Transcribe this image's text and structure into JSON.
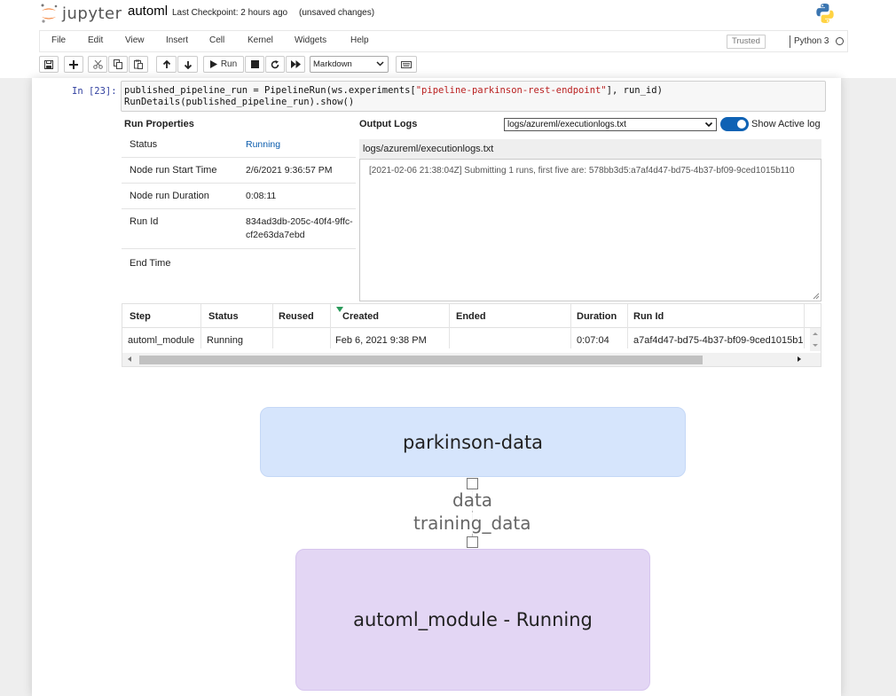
{
  "header": {
    "logo_text": "jupyter",
    "notebook_name": "automl",
    "checkpoint": "Last Checkpoint: 2 hours ago",
    "unsaved": "(unsaved changes)"
  },
  "menu": {
    "items": [
      "File",
      "Edit",
      "View",
      "Insert",
      "Cell",
      "Kernel",
      "Widgets",
      "Help"
    ],
    "trusted": "Trusted",
    "kernel_name": "Python 3"
  },
  "toolbar": {
    "run_label": "Run",
    "cell_type": "Markdown"
  },
  "cell": {
    "prompt": "In [23]:",
    "code_line1_a": "published_pipeline_run = PipelineRun(ws.experiments[",
    "code_line1_str": "\"pipeline-parkinson-rest-endpoint\"",
    "code_line1_b": "], run_id)",
    "code_line2": "RunDetails(published_pipeline_run).show()"
  },
  "run_properties": {
    "title": "Run Properties",
    "rows": [
      {
        "key": "Status",
        "value": "Running"
      },
      {
        "key": "Node run Start Time",
        "value": "2/6/2021 9:36:57 PM"
      },
      {
        "key": "Node run Duration",
        "value": "0:08:11"
      },
      {
        "key": "Run Id",
        "value": "834ad3db-205c-40f4-9ffc-cf2e63da7ebd"
      },
      {
        "key": "End Time",
        "value": ""
      }
    ]
  },
  "output_logs": {
    "title": "Output Logs",
    "selected_file": "logs/azureml/executionlogs.txt",
    "toggle_label": "Show Active log",
    "toggle_on": true,
    "log_header": "logs/azureml/executionlogs.txt",
    "log_text": "[2021-02-06 21:38:04Z] Submitting 1 runs, first five are: 578bb3d5:a7af4d47-bd75-4b37-bf09-9ced1015b110"
  },
  "steps_table": {
    "columns": [
      "Step",
      "Status",
      "Reused",
      "Created",
      "Ended",
      "Duration",
      "Run Id"
    ],
    "rows": [
      {
        "step": "automl_module",
        "status": "Running",
        "reused": "",
        "created": "Feb 6, 2021 9:38 PM",
        "ended": "",
        "duration": "0:07:04",
        "run_id": "a7af4d47-bd75-4b37-bf09-9ced1015b1"
      }
    ]
  },
  "graph": {
    "data_node": "parkinson-data",
    "edge_source_label": "data",
    "edge_target_label": "training_data",
    "module_node": "automl_module - Running"
  },
  "colors": {
    "link_blue": "#0b5cad",
    "toggle_blue": "#0f62b4",
    "data_node_bg": "#d6e5fc",
    "module_node_bg": "#e3d6f4"
  }
}
